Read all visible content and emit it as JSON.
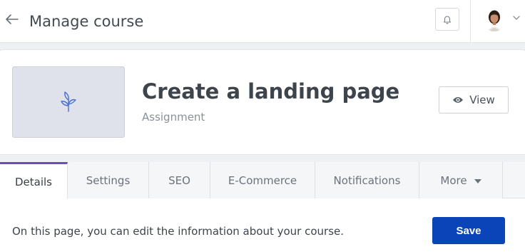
{
  "header": {
    "title": "Manage course",
    "back_icon": "arrow-left-icon",
    "notification_icon": "bell-icon",
    "user_menu_icon": "chevron-down-icon"
  },
  "course": {
    "title": "Create a landing page",
    "type": "Assignment",
    "thumbnail_icon": "plant-sprout-icon",
    "view_button_label": "View",
    "view_button_icon": "eye-icon"
  },
  "tabs": [
    {
      "label": "Details",
      "active": true
    },
    {
      "label": "Settings",
      "active": false
    },
    {
      "label": "SEO",
      "active": false
    },
    {
      "label": "E-Commerce",
      "active": false
    },
    {
      "label": "Notifications",
      "active": false
    },
    {
      "label": "More",
      "active": false
    }
  ],
  "content": {
    "info_text": "On this page, you can edit the information about your course.",
    "save_label": "Save"
  },
  "colors": {
    "accent_tab": "#6b4fbb",
    "primary_button": "#0b43b9",
    "thumbnail_bg": "#dfe2ea"
  }
}
